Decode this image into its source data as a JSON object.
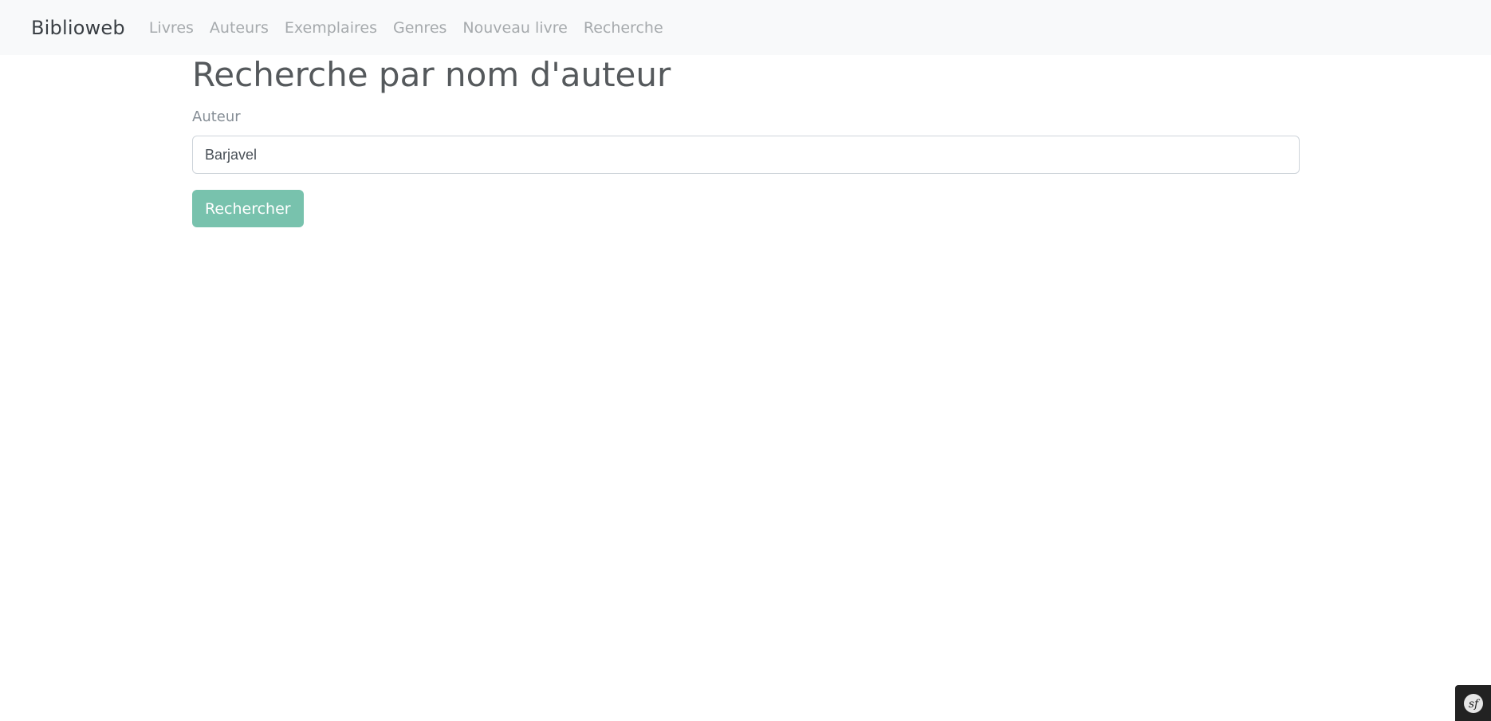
{
  "navbar": {
    "brand": "Biblioweb",
    "links": [
      {
        "label": "Livres"
      },
      {
        "label": "Auteurs"
      },
      {
        "label": "Exemplaires"
      },
      {
        "label": "Genres"
      },
      {
        "label": "Nouveau livre"
      },
      {
        "label": "Recherche"
      }
    ]
  },
  "main": {
    "title": "Recherche par nom d'auteur",
    "author_label": "Auteur",
    "author_value": "Barjavel",
    "submit_label": "Rechercher"
  },
  "debug_toolbar": {
    "icon": "symfony-logo-icon"
  },
  "colors": {
    "navbar_bg": "#f8f9fa",
    "accent": "#78c2ad",
    "toolbar_bg": "#222222"
  }
}
